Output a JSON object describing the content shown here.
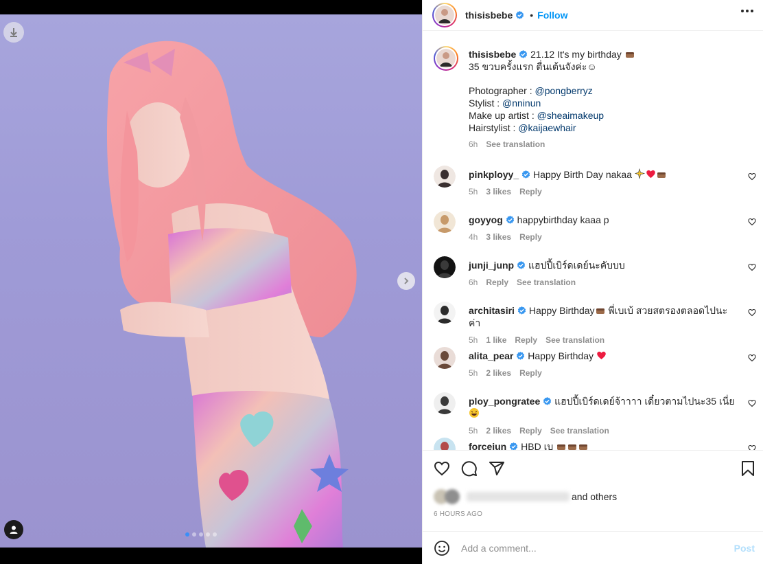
{
  "media": {
    "icons": {
      "download": "download-icon",
      "next": "chevron-right-icon",
      "tag": "user-tag-icon"
    },
    "carousel_total": 5,
    "carousel_active": 1
  },
  "post_header": {
    "username": "thisisbebe",
    "separator": "•",
    "follow_label": "Follow"
  },
  "caption": {
    "username": "thisisbebe",
    "line1": "21.12 It's my birthday",
    "line2": "35 ขวบครั้งแรก ตื่นเต้นจังค่ะ☺",
    "credits": [
      {
        "label": "Photographer : ",
        "handle": "@pongberryz"
      },
      {
        "label": "Stylist : ",
        "handle": "@nninun"
      },
      {
        "label": "Make up artist : ",
        "handle": "@sheaimakeup"
      },
      {
        "label": "Hairstylist : ",
        "handle": "@kaijaewhair"
      }
    ],
    "time": "6h",
    "translate": "See translation"
  },
  "comments": [
    {
      "username": "pinkployy_",
      "text": "Happy Birth Day nakaa",
      "time": "5h",
      "likes": "3 likes",
      "reply": "Reply",
      "translate": ""
    },
    {
      "username": "goyyog",
      "text": "happybirthday kaaa p",
      "time": "4h",
      "likes": "3 likes",
      "reply": "Reply",
      "translate": ""
    },
    {
      "username": "junji_junp",
      "text": "แฮปปี้เบิร์ดเดย์นะคับบบ",
      "time": "6h",
      "likes": "",
      "reply": "Reply",
      "translate": "See translation"
    },
    {
      "username": "architasiri",
      "text": "Happy Birthday",
      "text2": " พี่เบเบ้ สวยสตรองตลอดไปนะค่า",
      "time": "5h",
      "likes": "1 like",
      "reply": "Reply",
      "translate": "See translation"
    },
    {
      "username": "alita_pear",
      "text": "Happy Birthday",
      "time": "5h",
      "likes": "2 likes",
      "reply": "Reply",
      "translate": ""
    },
    {
      "username": "ploy_pongratee",
      "text": "แฮปปี้เบิร์ดเดย์จ้าาาา เดี๋ยวตามไปนะ35 เนี่ย",
      "time": "5h",
      "likes": "2 likes",
      "reply": "Reply",
      "translate": "See translation"
    },
    {
      "username": "forcejun",
      "text": "HBD เบ",
      "time": "",
      "likes": "",
      "reply": "",
      "translate": ""
    }
  ],
  "actions": {
    "icons": [
      "heart-icon",
      "comment-icon",
      "share-icon",
      "bookmark-icon"
    ],
    "liked_suffix": "and others",
    "time_ago": "6 HOURS AGO"
  },
  "add_comment": {
    "placeholder": "Add a comment...",
    "post_label": "Post",
    "emoji_icon": "smile-icon"
  },
  "colors": {
    "link": "#00376b",
    "follow": "#0095f6",
    "verified": "#3897f0",
    "post_disabled": "#b2dffc",
    "heart_red": "#ed4956"
  }
}
